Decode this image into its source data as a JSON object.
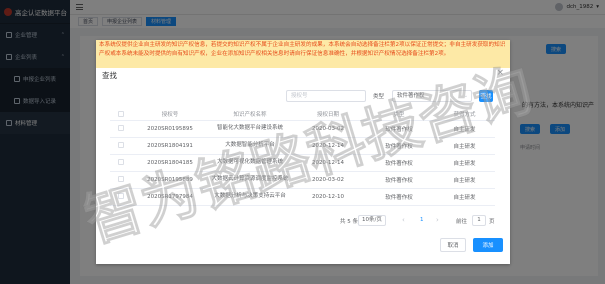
{
  "app": {
    "title": "高企认证数据平台",
    "user": "dch_1982"
  },
  "sidebar": {
    "items": [
      {
        "label": "企业管理"
      },
      {
        "label": "企业列表"
      },
      {
        "label": "申报企业列表"
      },
      {
        "label": "数据导入记录"
      },
      {
        "label": "材料管理"
      }
    ]
  },
  "tags": [
    "首页",
    "申报企业列表",
    "材料管理"
  ],
  "background": {
    "search_button": "搜索",
    "add_button": "添加",
    "right_text": "的有方法，本系统内知识产",
    "col_header": "申请时间"
  },
  "dialog": {
    "notice": "本系统仅提供企业自主研发的知识产权信息，若提交的知识产权不属于企业自主研发的成果，本系统会自动选择备注栏第2项以保证正常提交；非自主研发获取的知识产权或本系统未能及时提供的自有知识产权，企业在添加知识产权相关信息时请自行保证信息准确性，并根据知识产权情况选择备注栏第2项。",
    "title": "查找",
    "search_placeholder": "授权号",
    "type_label": "类型",
    "type_value": "软件著作权",
    "search_button": "查找",
    "columns": [
      "授权号",
      "知识产权名称",
      "授权日期",
      "类型",
      "获得方式"
    ],
    "rows": [
      {
        "auth_no": "2020SR0195895",
        "name": "智能化大数据平台建设系统",
        "date": "2020-03-02",
        "type": "软件著作权",
        "way": "自主研发"
      },
      {
        "auth_no": "2020SR1804191",
        "name": "大数据智能分析平台",
        "date": "2020-12-14",
        "type": "软件著作权",
        "way": "自主研发"
      },
      {
        "auth_no": "2020SR1804185",
        "name": "大数据可视化数据管理系统",
        "date": "2020-12-14",
        "type": "软件著作权",
        "way": "自主研发"
      },
      {
        "auth_no": "2020SR0195889",
        "name": "大数据云计算资源调度监控系统",
        "date": "2020-03-02",
        "type": "软件著作权",
        "way": "自主研发"
      },
      {
        "auth_no": "2020SR1797984",
        "name": "大数据分析与决策支持云平台",
        "date": "2020-12-10",
        "type": "软件著作权",
        "way": "自主研发"
      }
    ],
    "pagination": {
      "total": "共 5 条",
      "page_size": "10条/页",
      "current": "1",
      "goto_label": "前往",
      "goto_value": "1",
      "goto_unit": "页"
    },
    "cancel_label": "取消",
    "add_label": "添加"
  },
  "watermark": "智为铭路科技咨询",
  "colors": {
    "primary": "#1890ff",
    "notice_bg": "#fde9a6",
    "notice_text": "#e64a19",
    "sidebar": "#1f2d3d"
  }
}
